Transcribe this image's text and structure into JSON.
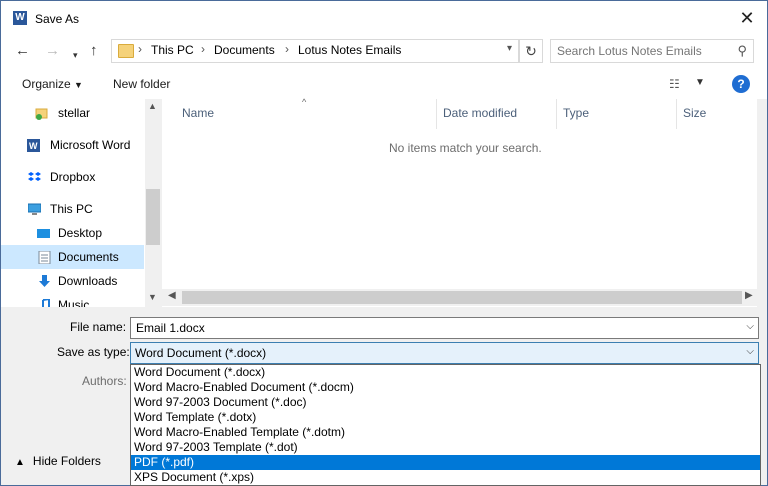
{
  "window": {
    "title": "Save As"
  },
  "address": {
    "crumbs": [
      "This PC",
      "Documents",
      "Lotus Notes Emails"
    ]
  },
  "search": {
    "placeholder": "Search Lotus Notes Emails"
  },
  "toolbar": {
    "organize_label": "Organize",
    "new_folder_label": "New folder"
  },
  "nav": {
    "items": [
      {
        "label": "stellar",
        "icon": "folder-check-icon"
      },
      {
        "label": "Microsoft Word",
        "icon": "word-icon"
      },
      {
        "label": "Dropbox",
        "icon": "dropbox-icon"
      },
      {
        "label": "This PC",
        "icon": "computer-icon"
      },
      {
        "label": "Desktop",
        "icon": "desktop-icon"
      },
      {
        "label": "Documents",
        "icon": "documents-icon",
        "selected": true
      },
      {
        "label": "Downloads",
        "icon": "download-icon"
      },
      {
        "label": "Music",
        "icon": "music-icon"
      }
    ]
  },
  "list": {
    "columns": [
      "Name",
      "Date modified",
      "Type",
      "Size"
    ],
    "empty_message": "No items match your search."
  },
  "form": {
    "file_name_label": "File name:",
    "file_name_value": "Email 1.docx",
    "save_type_label": "Save as type:",
    "save_type_value": "Word Document (*.docx)",
    "authors_label": "Authors:",
    "hide_folders_label": "Hide Folders"
  },
  "save_type_options": [
    "Word Document (*.docx)",
    "Word Macro-Enabled Document (*.docm)",
    "Word 97-2003 Document (*.doc)",
    "Word Template (*.dotx)",
    "Word Macro-Enabled Template (*.dotm)",
    "Word 97-2003 Template (*.dot)",
    "PDF (*.pdf)",
    "XPS Document (*.xps)"
  ],
  "selected_option": "PDF (*.pdf)",
  "colors": {
    "accent": "#0078d7",
    "selection": "#cce8ff",
    "help": "#1f6dd2"
  }
}
